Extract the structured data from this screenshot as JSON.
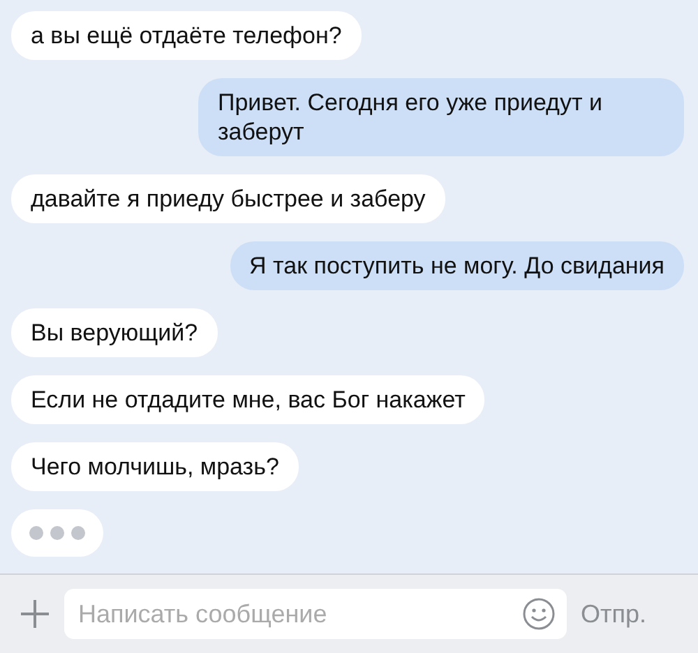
{
  "messages": [
    {
      "kind": "incoming",
      "text": "а вы ещё отдаёте телефон?"
    },
    {
      "kind": "outgoing",
      "text": "Привет. Сегодня его уже приедут и заберут"
    },
    {
      "kind": "incoming",
      "text": "давайте я приеду быстрее и заберу"
    },
    {
      "kind": "outgoing",
      "text": "Я так поступить не могу. До свидания"
    },
    {
      "kind": "incoming",
      "text": "Вы верующий?"
    },
    {
      "kind": "incoming",
      "text": "Если не отдадите мне, вас Бог накажет"
    },
    {
      "kind": "incoming",
      "text": "Чего молчишь, мразь?"
    },
    {
      "kind": "typing"
    }
  ],
  "composer": {
    "placeholder": "Написать сообщение",
    "send_label": "Отпр."
  }
}
